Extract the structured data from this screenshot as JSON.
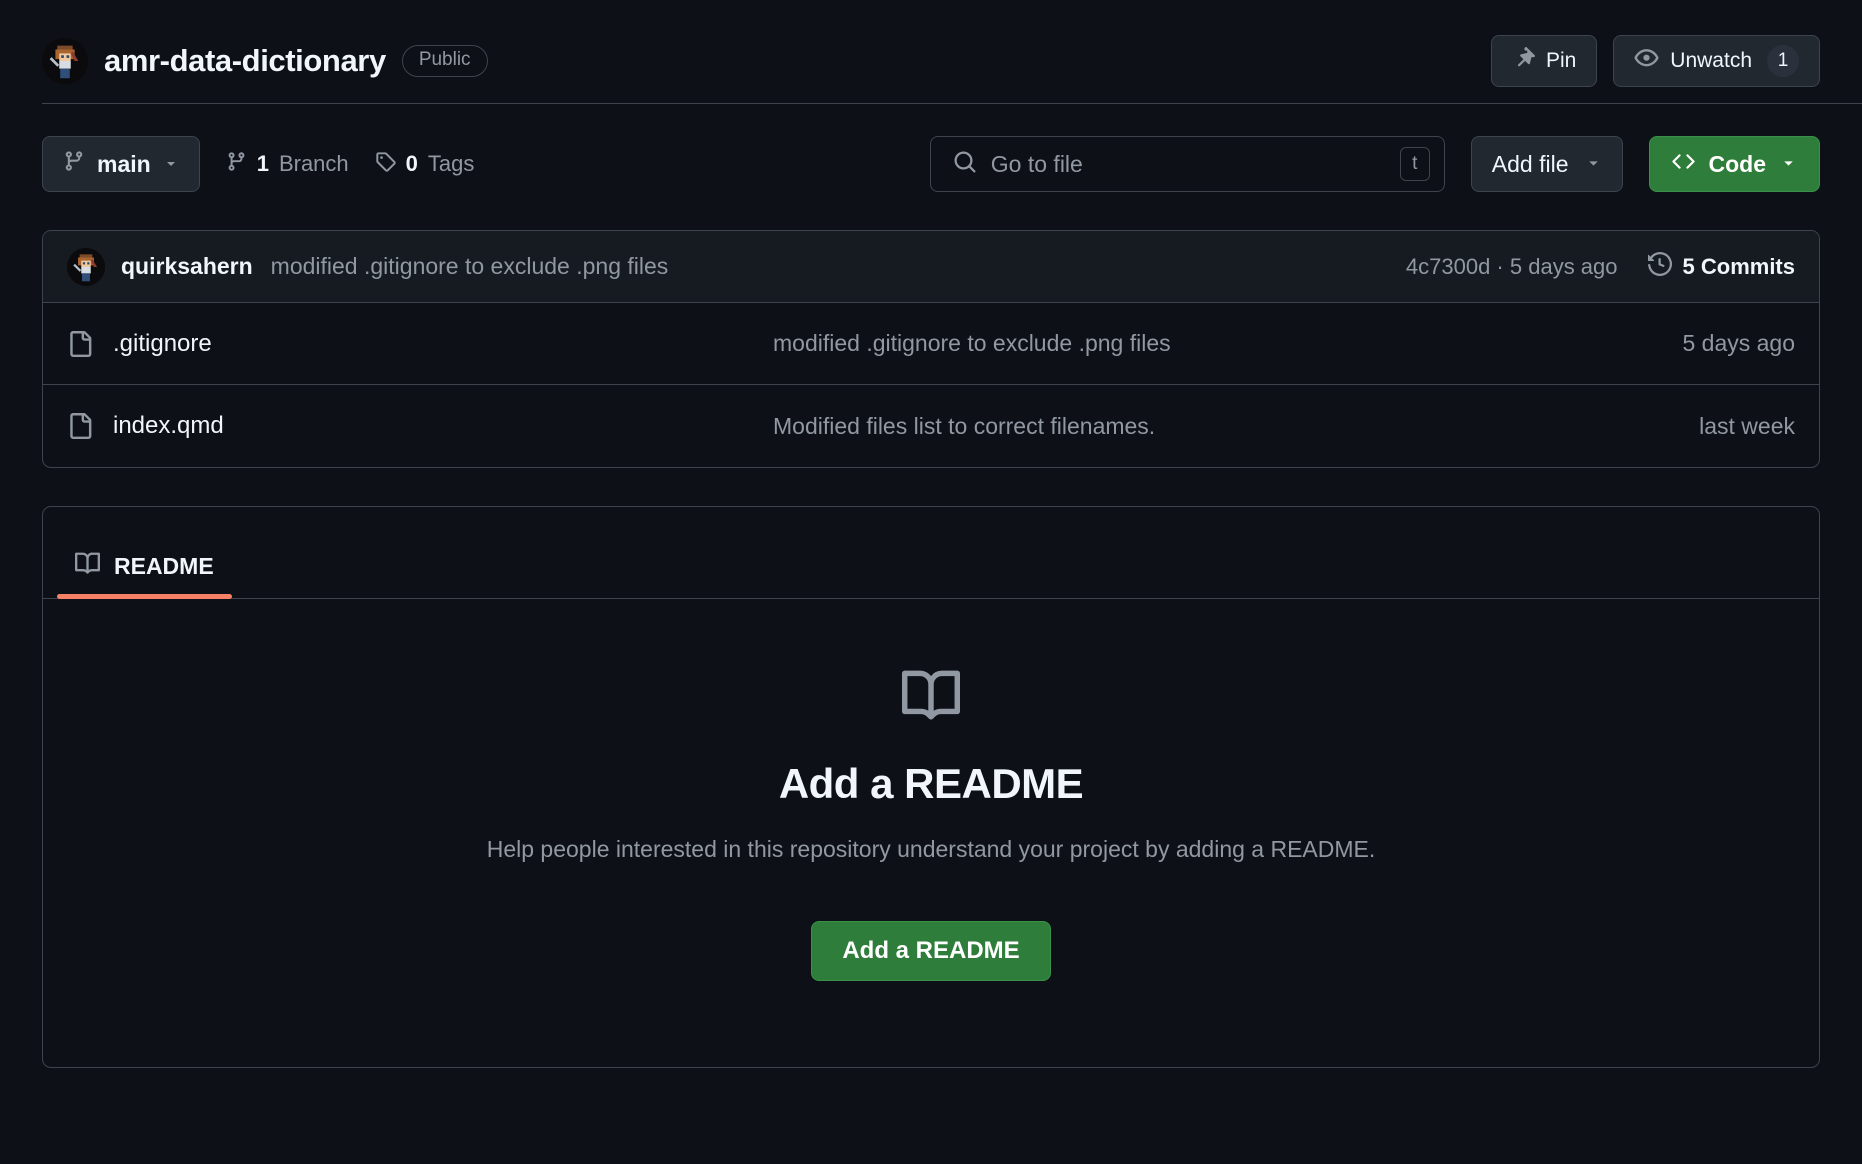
{
  "header": {
    "repo_name": "amr-data-dictionary",
    "visibility": "Public",
    "avatar_icon": "owner-avatar-pixel-art",
    "pin_label": "Pin",
    "pin_icon": "pin-icon",
    "unwatch_label": "Unwatch",
    "unwatch_icon": "eye-icon",
    "watch_count": "1"
  },
  "toolbar": {
    "branch_name": "main",
    "branch_icon": "git-branch-icon",
    "branch_chevron_icon": "chevron-down-icon",
    "branches_count": "1",
    "branches_label": "Branch",
    "tags_count": "0",
    "tags_label": "Tags",
    "tag_icon": "tag-icon",
    "search_placeholder": "Go to file",
    "search_value": "",
    "search_icon": "search-icon",
    "search_kbd": "t",
    "add_file_label": "Add file",
    "add_file_chevron_icon": "chevron-down-icon",
    "code_label": "Code",
    "code_icon": "code-brackets-icon",
    "code_chevron_icon": "chevron-down-icon",
    "code_button_color": "#2f7d3a"
  },
  "commit_header": {
    "author": "quirksahern",
    "message": "modified .gitignore to exclude .png files",
    "hash_and_time": "4c7300d · 5 days ago",
    "commits_count": "5 Commits",
    "history_icon": "history-clock-icon",
    "avatar_icon": "author-avatar-pixel-art"
  },
  "files": [
    {
      "name": ".gitignore",
      "icon": "file-icon",
      "commit_message": "modified .gitignore to exclude .png files",
      "time": "5 days ago"
    },
    {
      "name": "index.qmd",
      "icon": "file-icon",
      "commit_message": "Modified files list to correct filenames.",
      "time": "last week"
    }
  ],
  "readme": {
    "tab_label": "README",
    "tab_icon": "book-icon",
    "tab_underline_color": "#f78166",
    "empty_icon": "book-icon-large",
    "empty_title": "Add a README",
    "empty_description": "Help people interested in this repository understand your project by adding a README.",
    "empty_button_label": "Add a README",
    "empty_button_color": "#2f7d3a"
  }
}
